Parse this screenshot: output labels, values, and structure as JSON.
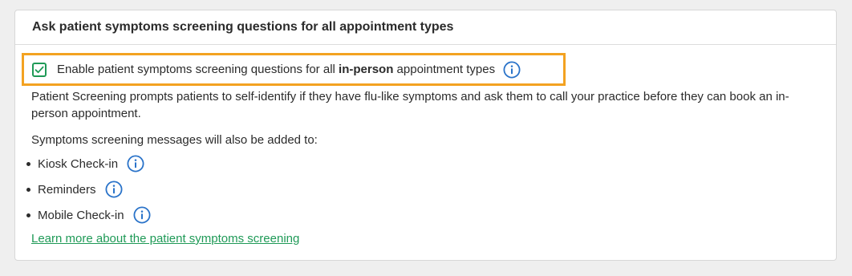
{
  "section": {
    "title": "Ask patient symptoms screening questions for all appointment types"
  },
  "option": {
    "checked": true,
    "label_before": "Enable patient symptoms screening questions for all ",
    "label_bold": "in-person",
    "label_after": " appointment types"
  },
  "description": "Patient Screening prompts patients to self-identify if they have flu-like symptoms and ask them to call your practice before they can book an in-person appointment.",
  "also_added": {
    "intro": "Symptoms screening messages will also be added to:",
    "items": [
      {
        "label": "Kiosk Check-in"
      },
      {
        "label": "Reminders"
      },
      {
        "label": "Mobile Check-in"
      }
    ]
  },
  "learn_more_link": "Learn more about the patient symptoms screening",
  "colors": {
    "highlight": "#f3a221",
    "check_green": "#1f9a57",
    "info_blue": "#2a73c9",
    "link_green": "#1f9a57"
  }
}
